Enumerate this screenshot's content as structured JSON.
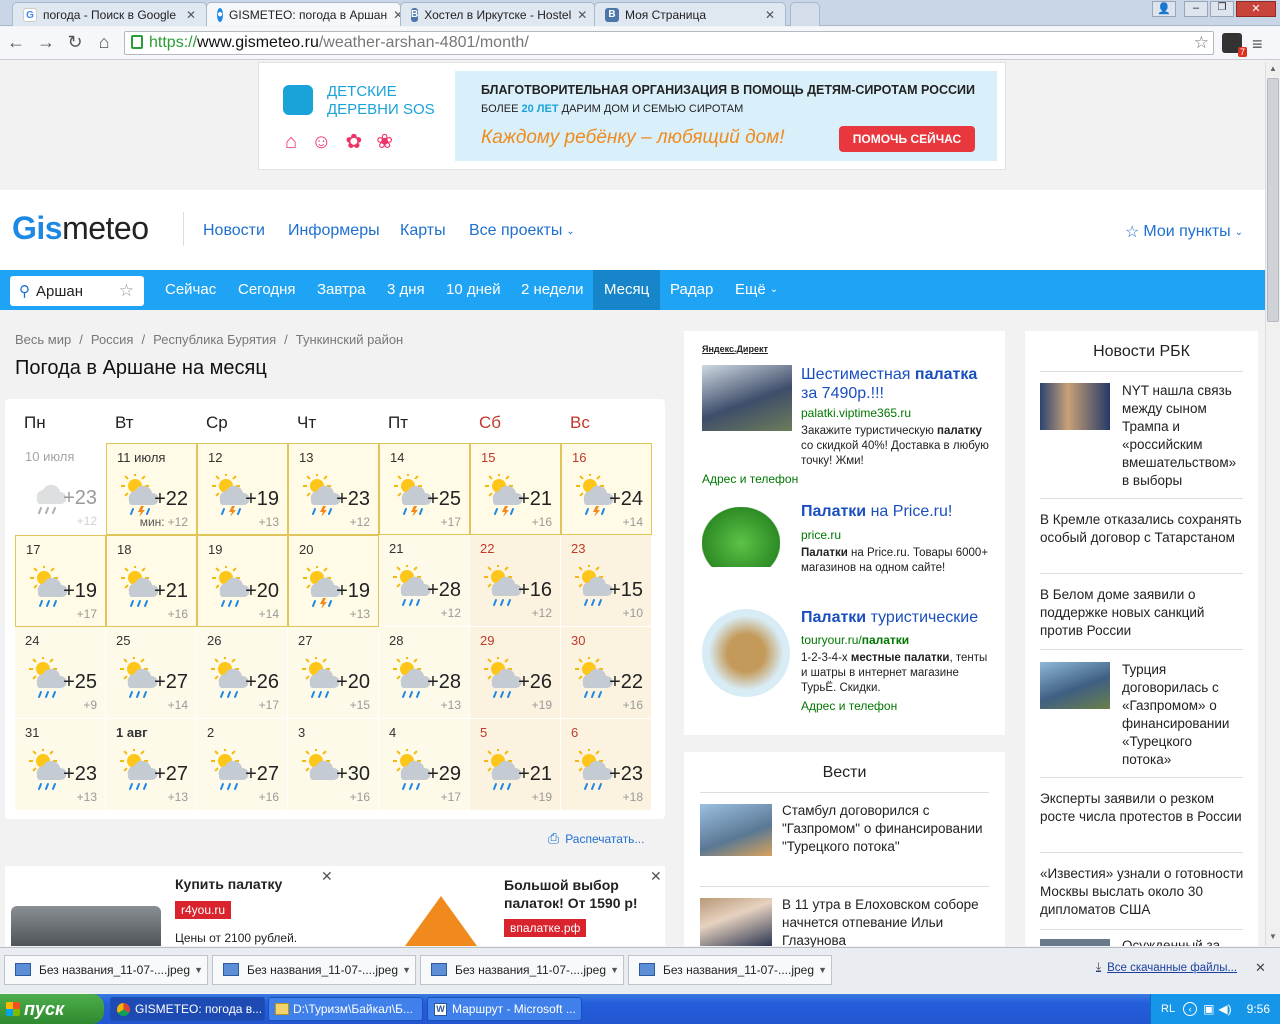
{
  "browser": {
    "tabs": [
      {
        "title": "погода - Поиск в Google",
        "icon": "google-icon"
      },
      {
        "title": "GISMETEO: погода в Аршан",
        "icon": "gismeteo-icon"
      },
      {
        "title": "Хостел в Иркутске - Hostel",
        "icon": "vk-icon"
      },
      {
        "title": "Моя Страница",
        "icon": "vk-icon"
      }
    ],
    "url_proto": "https://",
    "url_host": "www.gismeteo.ru",
    "url_path": "/weather-arshan-4801/month/",
    "ext_badge": "7"
  },
  "top_ad": {
    "org_name_1": "ДЕТСКИЕ",
    "org_name_2": "ДЕРЕВНИ SOS",
    "headline": "БЛАГОТВОРИТЕЛЬНАЯ ОРГАНИЗАЦИЯ В ПОМОЩЬ ДЕТЯМ-СИРОТАМ РОССИИ",
    "sub_a": "БОЛЕЕ ",
    "sub_b": "20 ЛЕТ",
    "sub_c": " ДАРИМ ДОМ И СЕМЬЮ СИРОТАМ",
    "slogan": "Каждому ребёнку – любящий дом!",
    "cta": "ПОМОЧЬ СЕЙЧАС"
  },
  "header": {
    "logo_a": "Gis",
    "logo_b": "meteo",
    "nav": [
      "Новости",
      "Информеры",
      "Карты",
      "Все проекты"
    ],
    "my_points": "Мои пункты"
  },
  "bluebar": {
    "search_value": "Аршан",
    "tabs": [
      "Сейчас",
      "Сегодня",
      "Завтра",
      "3 дня",
      "10 дней",
      "2 недели",
      "Месяц",
      "Радар",
      "Ещё"
    ],
    "active": "Месяц"
  },
  "breadcrumbs": [
    "Весь мир",
    "Россия",
    "Республика Бурятия",
    "Тункинский район"
  ],
  "page_title": "Погода в Аршане на месяц",
  "calendar": {
    "weekdays": [
      "Пн",
      "Вт",
      "Ср",
      "Чт",
      "Пт",
      "Сб",
      "Вс"
    ],
    "min_label": "мин:",
    "days": [
      {
        "d": "10 июля",
        "hi": "+23",
        "lo": "+12",
        "past": true,
        "icon": "cloud-rain-icon"
      },
      {
        "d": "11 июля",
        "hi": "+22",
        "lo": "+12",
        "hl": true,
        "icon": "sun-cloud-storm-icon",
        "showmin": true
      },
      {
        "d": "12",
        "hi": "+19",
        "lo": "+13",
        "hl": true,
        "icon": "sun-cloud-storm-icon"
      },
      {
        "d": "13",
        "hi": "+23",
        "lo": "+12",
        "hl": true,
        "icon": "sun-cloud-storm-icon"
      },
      {
        "d": "14",
        "hi": "+25",
        "lo": "+17",
        "hl": true,
        "icon": "sun-cloud-storm-icon"
      },
      {
        "d": "15",
        "hi": "+21",
        "lo": "+16",
        "hl": true,
        "red": true,
        "icon": "sun-cloud-storm-icon"
      },
      {
        "d": "16",
        "hi": "+24",
        "lo": "+14",
        "hl": true,
        "red": true,
        "icon": "sun-cloud-storm-icon"
      },
      {
        "d": "17",
        "hi": "+19",
        "lo": "+17",
        "hl": true,
        "icon": "sun-cloud-rain-icon"
      },
      {
        "d": "18",
        "hi": "+21",
        "lo": "+16",
        "hl": true,
        "icon": "sun-cloud-rain-icon"
      },
      {
        "d": "19",
        "hi": "+20",
        "lo": "+14",
        "hl": true,
        "icon": "sun-cloud-rain-icon"
      },
      {
        "d": "20",
        "hi": "+19",
        "lo": "+13",
        "hl": true,
        "icon": "sun-cloud-storm-icon"
      },
      {
        "d": "21",
        "hi": "+28",
        "lo": "+12",
        "icon": "sun-cloud-rain-icon"
      },
      {
        "d": "22",
        "hi": "+16",
        "lo": "+12",
        "red": true,
        "icon": "sun-cloud-rain-icon"
      },
      {
        "d": "23",
        "hi": "+15",
        "lo": "+10",
        "red": true,
        "icon": "sun-cloud-rain-icon"
      },
      {
        "d": "24",
        "hi": "+25",
        "lo": "+9",
        "icon": "sun-cloud-rain-icon"
      },
      {
        "d": "25",
        "hi": "+27",
        "lo": "+14",
        "icon": "sun-cloud-rain-icon"
      },
      {
        "d": "26",
        "hi": "+26",
        "lo": "+17",
        "icon": "sun-cloud-rain-icon"
      },
      {
        "d": "27",
        "hi": "+20",
        "lo": "+15",
        "icon": "sun-cloud-rain-icon"
      },
      {
        "d": "28",
        "hi": "+28",
        "lo": "+13",
        "icon": "sun-cloud-rain-icon"
      },
      {
        "d": "29",
        "hi": "+26",
        "lo": "+19",
        "red": true,
        "icon": "sun-cloud-rain-icon"
      },
      {
        "d": "30",
        "hi": "+22",
        "lo": "+16",
        "red": true,
        "icon": "sun-cloud-rain-icon"
      },
      {
        "d": "31",
        "hi": "+23",
        "lo": "+13",
        "icon": "sun-cloud-rain-icon"
      },
      {
        "d": "1 авг",
        "hi": "+27",
        "lo": "+13",
        "bold": true,
        "icon": "sun-cloud-rain-icon"
      },
      {
        "d": "2",
        "hi": "+27",
        "lo": "+16",
        "icon": "sun-cloud-rain-icon"
      },
      {
        "d": "3",
        "hi": "+30",
        "lo": "+16",
        "icon": "sun-cloud-icon"
      },
      {
        "d": "4",
        "hi": "+29",
        "lo": "+17",
        "icon": "sun-cloud-rain-icon"
      },
      {
        "d": "5",
        "hi": "+21",
        "lo": "+19",
        "red": true,
        "icon": "sun-cloud-rain-icon"
      },
      {
        "d": "6",
        "hi": "+23",
        "lo": "+18",
        "red": true,
        "icon": "sun-cloud-rain-icon"
      }
    ]
  },
  "print_label": "Распечатать...",
  "bottom_ads": [
    {
      "title": "Купить палатку",
      "domain": "r4you.ru",
      "text": "Цены от 2100 рублей."
    },
    {
      "title": "Большой выбор палаток! От 1590 р!",
      "domain": "впалатке.рф"
    }
  ],
  "yandex_direct": {
    "label": "Яндекс.Директ",
    "ads": [
      {
        "title_a": "Шестиместная ",
        "title_b": "палатка",
        "title_c": " за 7490р.!!!",
        "domain": "palatki.viptime365.ru",
        "text_a": "Закажите туристическую ",
        "text_b": "палатку",
        "text_c": " со скидкой 40%! Доставка в любую точку! Жми!",
        "extra": "Адрес и телефон"
      },
      {
        "title_a": "Палатки",
        "title_b": " на Price.ru!",
        "domain": "price.ru",
        "text_a": "Палатки",
        "text_b": " на Price.ru. Товары 6000+ магазинов на одном сайте!"
      },
      {
        "title_a": "Палатки",
        "title_b": " туристические",
        "domain_a": "touryour.ru/",
        "domain_b": "палатки",
        "text_a": "1-2-3-4-х ",
        "text_b": "местные палатки",
        "text_c": ", тенты и шатры в интернет магазине ТурьЁ. Скидки.",
        "extra": "Адрес и телефон"
      }
    ]
  },
  "vesti": {
    "title": "Вести",
    "items": [
      "Стамбул договорился с \"Газпромом\" о финансировании \"Турецкого потока\"",
      "В 11 утра в Елоховском соборе начнется отпевание Ильи Глазунова"
    ]
  },
  "rbk": {
    "title": "Новости РБК",
    "items": [
      "NYT нашла связь между сыном Трампа и «российским вмешательством» в выборы",
      "В Кремле отказались сохранять особый договор с Татарстаном",
      "В Белом доме заявили о поддержке новых санкций против России",
      "Турция договорилась с «Газпромом» о финансировании «Турецкого потока»",
      "Эксперты заявили о резком росте числа протестов в России",
      "«Известия» узнали о готовности Москвы выслать около 30 дипломатов США",
      "Осужденный за"
    ]
  },
  "downloads": {
    "files": [
      "Без названия_11-07-....jpeg",
      "Без названия_11-07-....jpeg",
      "Без названия_11-07-....jpeg",
      "Без названия_11-07-....jpeg"
    ],
    "all": "Все скачанные файлы..."
  },
  "taskbar": {
    "start": "пуск",
    "items": [
      "GISMETEO: погода в...",
      "D:\\Туризм\\Байкал\\Б...",
      "Маршрут - Microsoft ..."
    ],
    "lang": "RL",
    "time": "9:56"
  }
}
